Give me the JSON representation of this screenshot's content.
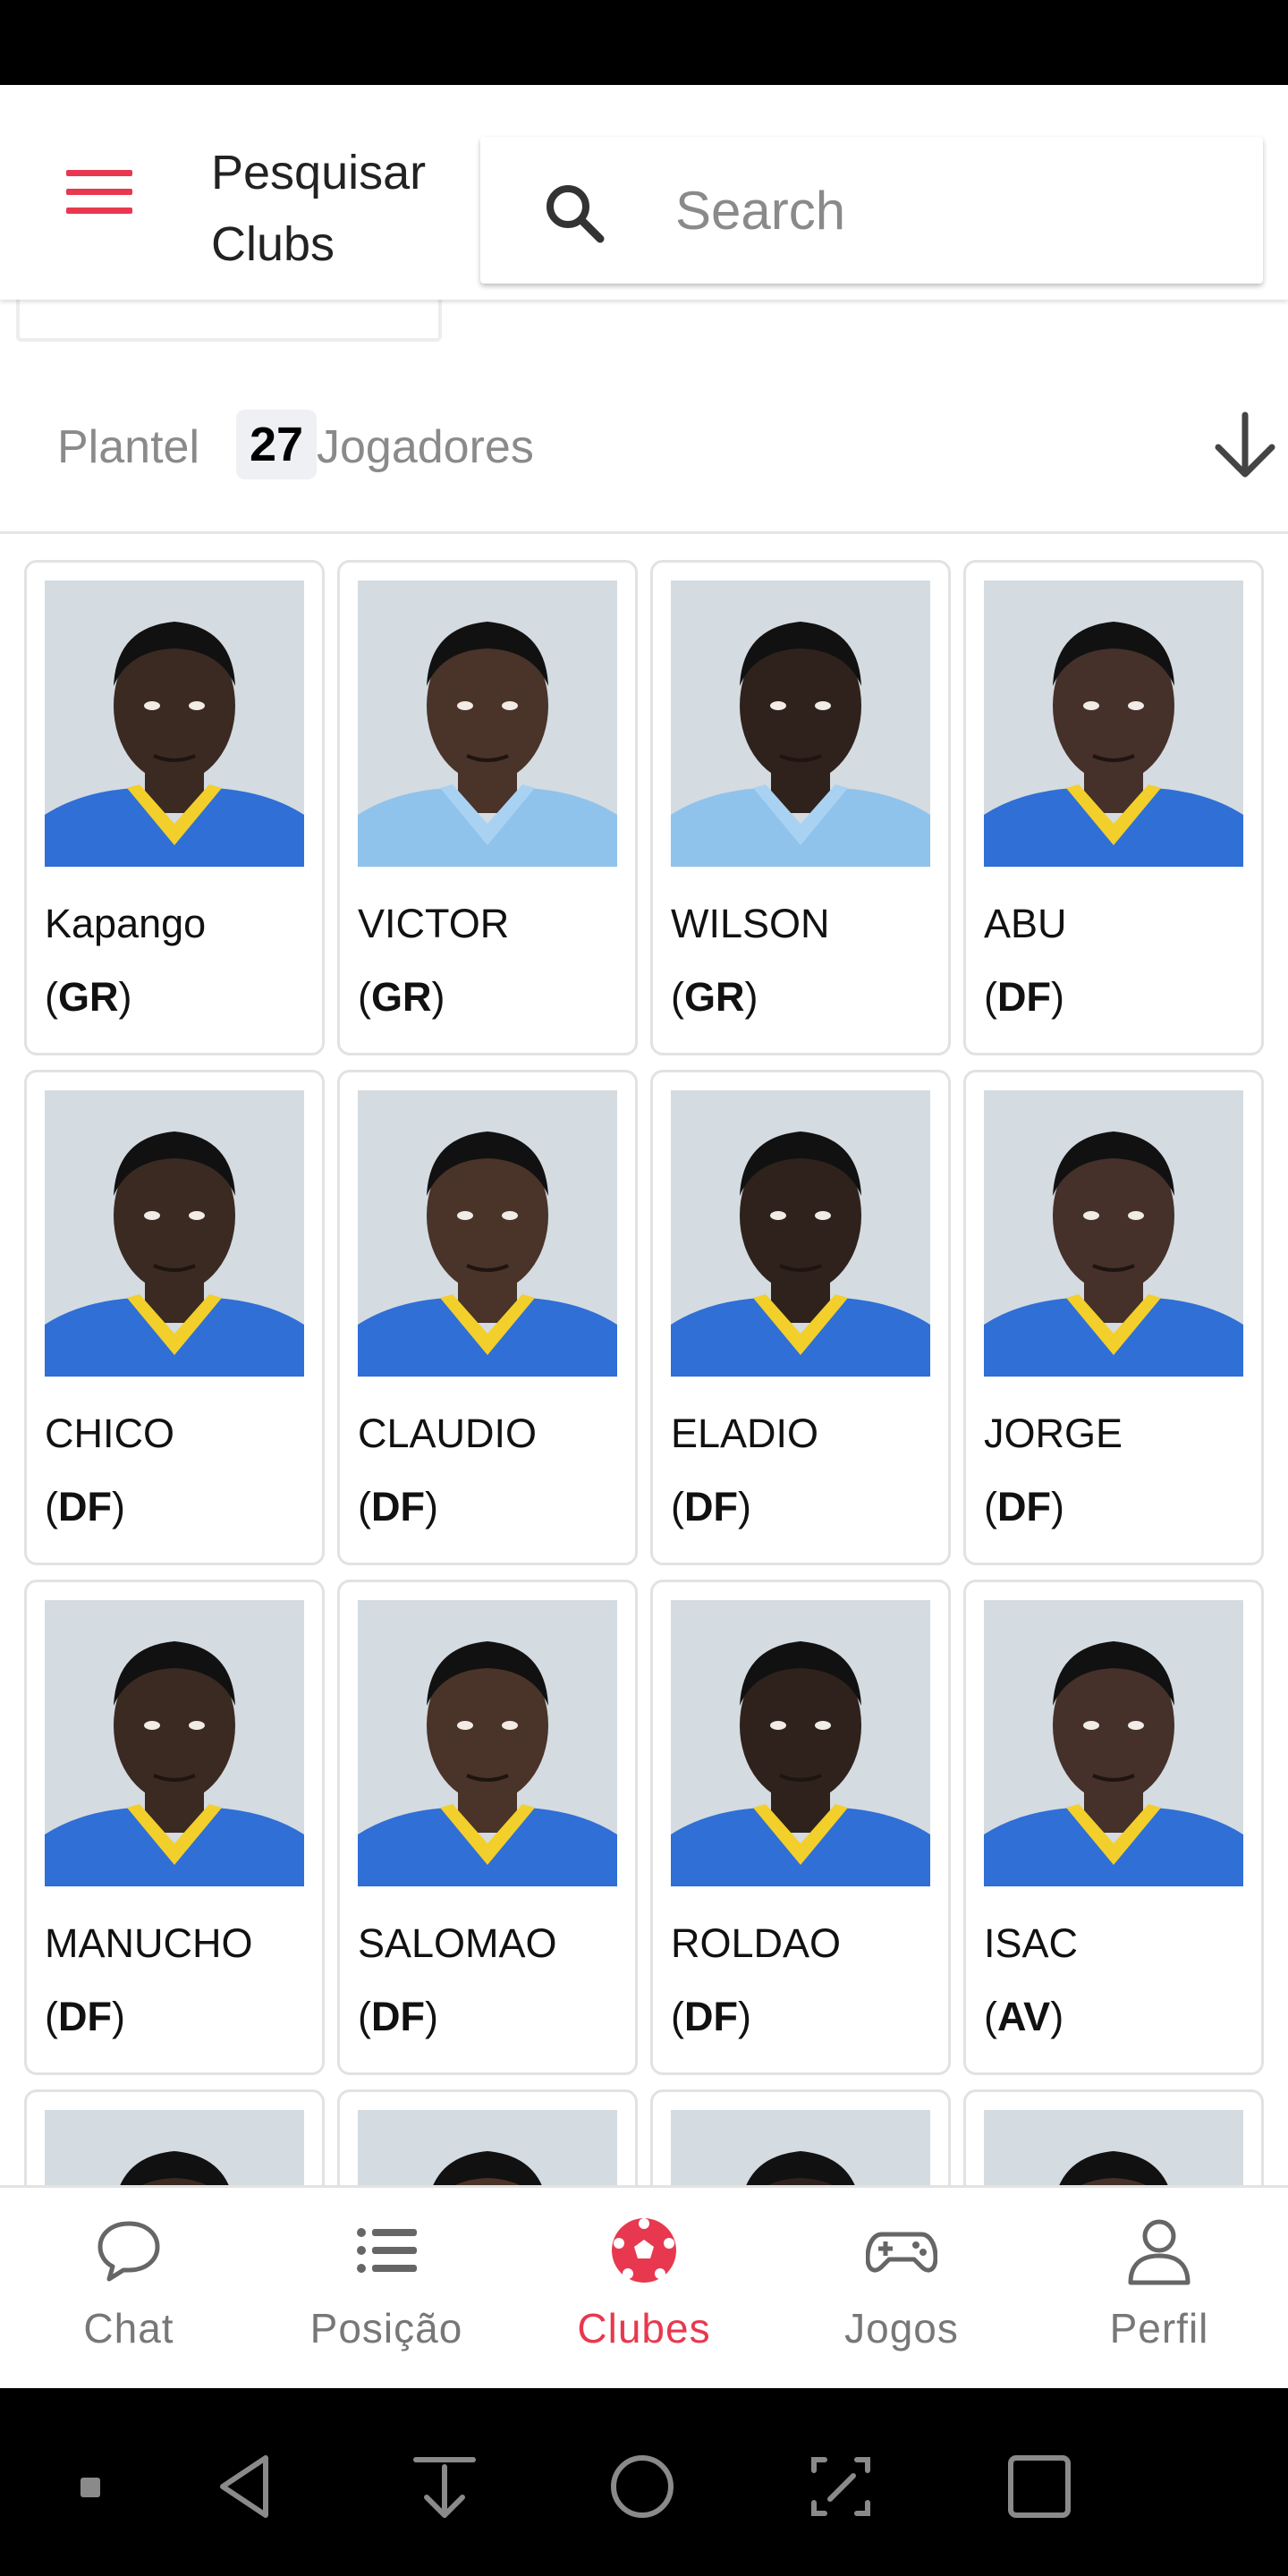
{
  "header": {
    "title": "Pesquisar Clubs",
    "search_placeholder": "Search"
  },
  "roster": {
    "label": "Plantel",
    "count": "27",
    "suffix": "Jogadores"
  },
  "players": [
    {
      "name": "Kapango",
      "position": "GR",
      "kit": "home"
    },
    {
      "name": "VICTOR",
      "position": "GR",
      "kit": "sky"
    },
    {
      "name": "WILSON",
      "position": "GR",
      "kit": "sky"
    },
    {
      "name": "ABU",
      "position": "DF",
      "kit": "home"
    },
    {
      "name": "CHICO",
      "position": "DF",
      "kit": "home"
    },
    {
      "name": "CLAUDIO",
      "position": "DF",
      "kit": "home"
    },
    {
      "name": "ELADIO",
      "position": "DF",
      "kit": "home"
    },
    {
      "name": "JORGE",
      "position": "DF",
      "kit": "home"
    },
    {
      "name": "MANUCHO",
      "position": "DF",
      "kit": "home"
    },
    {
      "name": "SALOMAO",
      "position": "DF",
      "kit": "home"
    },
    {
      "name": "ROLDAO",
      "position": "DF",
      "kit": "home"
    },
    {
      "name": "ISAC",
      "position": "AV",
      "kit": "home"
    },
    {
      "name": "",
      "position": "",
      "kit": "partial"
    },
    {
      "name": "",
      "position": "",
      "kit": "partial"
    },
    {
      "name": "",
      "position": "",
      "kit": "partial"
    },
    {
      "name": "",
      "position": "",
      "kit": "partial"
    }
  ],
  "nav": [
    {
      "label": "Chat",
      "icon": "chat-bubble-icon",
      "active": false
    },
    {
      "label": "Posição",
      "icon": "list-icon",
      "active": false
    },
    {
      "label": "Clubes",
      "icon": "soccer-ball-icon",
      "active": true
    },
    {
      "label": "Jogos",
      "icon": "gamepad-icon",
      "active": false
    },
    {
      "label": "Perfil",
      "icon": "person-icon",
      "active": false
    }
  ],
  "colors": {
    "accent": "#e8384f",
    "kit_blue": "#2f6fd6",
    "kit_yellow": "#f2cf2a",
    "kit_sky": "#8fc3ec"
  }
}
